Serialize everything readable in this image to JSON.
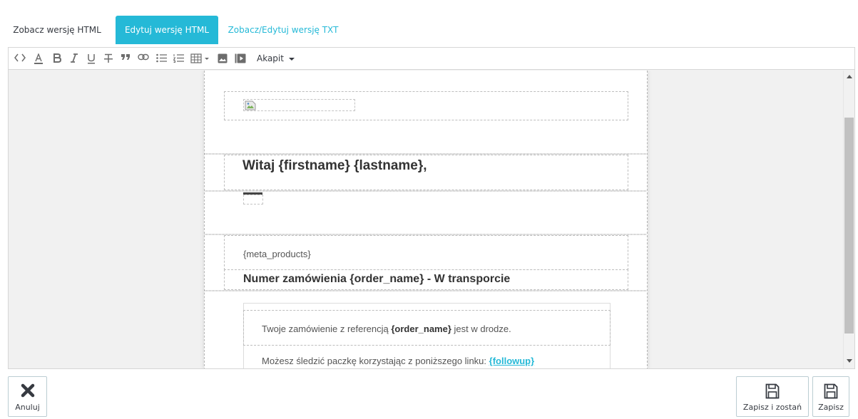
{
  "tabs": [
    {
      "label": "Zobacz wersję HTML"
    },
    {
      "label": "Edytuj wersję HTML"
    },
    {
      "label": "Zobacz/Edytuj wersję TXT"
    }
  ],
  "toolbar": {
    "paragraph_label": "Akapit",
    "icons": [
      "code-icon",
      "text-color-icon",
      "bold-icon",
      "italic-icon",
      "underline-icon",
      "strikethrough-icon",
      "quote-icon",
      "link-icon",
      "bullet-list-icon",
      "numbered-list-icon",
      "table-icon",
      "image-icon",
      "video-icon"
    ]
  },
  "email": {
    "greeting": "Witaj {firstname} {lastname},",
    "meta_products": "{meta_products}",
    "order_title": "Numer zamówienia {order_name} - W transporcie",
    "line1_before": "Twoje zamówienie z referencją ",
    "line1_bold": "{order_name}",
    "line1_after": " jest w drodze.",
    "line2_before": "Możesz śledzić paczkę korzystając z poniższego linku: ",
    "line2_link": "{followup}"
  },
  "buttons": {
    "cancel": "Anuluj",
    "save_stay": "Zapisz i zostań",
    "save": "Zapisz"
  },
  "colors": {
    "accent": "#25b9d7",
    "text": "#363a41"
  }
}
